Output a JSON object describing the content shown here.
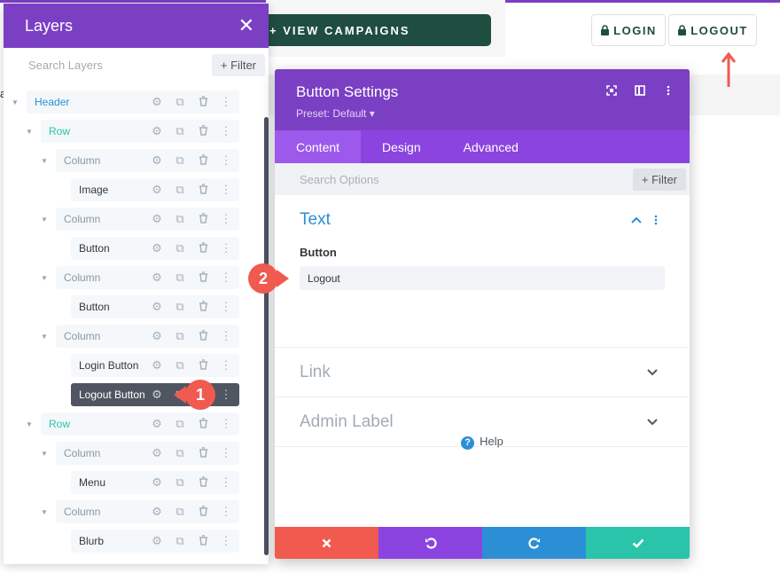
{
  "page": {
    "partial_letter": "a",
    "view_campaigns": "+ VIEW CAMPAIGNS",
    "login": "LOGIN",
    "logout": "LOGOUT"
  },
  "layers": {
    "title": "Layers",
    "close": "✕",
    "search_placeholder": "Search Layers",
    "filter": "+ Filter",
    "items": [
      {
        "label": "Header",
        "kind": "section"
      },
      {
        "label": "Row",
        "kind": "row"
      },
      {
        "label": "Column",
        "kind": "column"
      },
      {
        "label": "Image",
        "kind": "module"
      },
      {
        "label": "Column",
        "kind": "column"
      },
      {
        "label": "Button",
        "kind": "module"
      },
      {
        "label": "Column",
        "kind": "column"
      },
      {
        "label": "Button",
        "kind": "module"
      },
      {
        "label": "Column",
        "kind": "column"
      },
      {
        "label": "Login Button",
        "kind": "module"
      },
      {
        "label": "Logout Button",
        "kind": "module",
        "active": true
      },
      {
        "label": "Row",
        "kind": "row"
      },
      {
        "label": "Column",
        "kind": "column"
      },
      {
        "label": "Menu",
        "kind": "module"
      },
      {
        "label": "Column",
        "kind": "column"
      },
      {
        "label": "Blurb",
        "kind": "module"
      }
    ]
  },
  "settings": {
    "title": "Button Settings",
    "preset": "Preset: Default ▾",
    "tabs": [
      "Content",
      "Design",
      "Advanced"
    ],
    "active_tab": "Content",
    "search_placeholder": "Search Options",
    "filter": "+ Filter",
    "text_section": "Text",
    "button_label": "Button",
    "button_value": "Logout",
    "link_section": "Link",
    "admin_section": "Admin Label",
    "help": "Help",
    "footer_icons": [
      "close-icon",
      "undo-icon",
      "redo-icon",
      "check-icon"
    ]
  },
  "callouts": {
    "one": "1",
    "two": "2"
  },
  "colors": {
    "purple_dark": "#7b3fc4",
    "purple_tab": "#8c44e0",
    "blue": "#2c8fd6",
    "teal": "#29c4a9",
    "red": "#f05a4f",
    "green_button": "#1f4d3f",
    "footer": [
      "#f05a4f",
      "#8c44e0",
      "#2c8fd6",
      "#29c4a9"
    ]
  }
}
